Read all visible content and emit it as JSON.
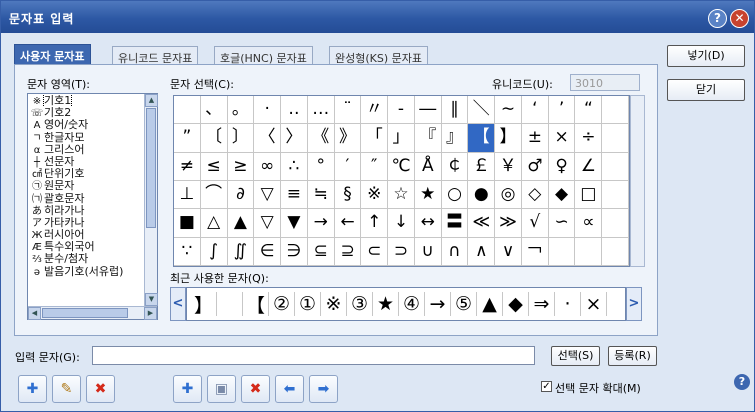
{
  "window": {
    "title": "문자표 입력",
    "help_glyph": "?",
    "close_glyph": "✕"
  },
  "tabs": [
    {
      "label": "사용자 문자표",
      "active": true
    },
    {
      "label": "유니코드 문자표",
      "active": false
    },
    {
      "label": "호글(HNC) 문자표",
      "active": false
    },
    {
      "label": "완성형(KS) 문자표",
      "active": false
    }
  ],
  "area_label": "문자 영역(T):",
  "areas": [
    {
      "icon": "※",
      "label": "기호1",
      "selected": true
    },
    {
      "icon": "☏",
      "label": "기호2"
    },
    {
      "icon": "A",
      "label": "영어/숫자"
    },
    {
      "icon": "ㄱ",
      "label": "한글자모"
    },
    {
      "icon": "α",
      "label": "그리스어"
    },
    {
      "icon": "┼",
      "label": "선문자"
    },
    {
      "icon": "㎠",
      "label": "단위기호"
    },
    {
      "icon": "㉠",
      "label": "원문자"
    },
    {
      "icon": "㈀",
      "label": "괄호문자"
    },
    {
      "icon": "あ",
      "label": "히라가나"
    },
    {
      "icon": "ア",
      "label": "가타카나"
    },
    {
      "icon": "Ж",
      "label": "러시아어"
    },
    {
      "icon": "Æ",
      "label": "특수외국어"
    },
    {
      "icon": "⅔",
      "label": "분수/첨자"
    },
    {
      "icon": "ǝ",
      "label": "발음기호(서유럽)"
    }
  ],
  "select_label": "문자 선택(C):",
  "unicode_label": "유니코드(U):",
  "unicode_value": "3010",
  "grid": [
    [
      "",
      "、",
      "。",
      "·",
      "‥",
      "…",
      "¨",
      "〃",
      "-",
      "―",
      "∥",
      "＼",
      "∼",
      "‘",
      "’",
      "“",
      ""
    ],
    [
      "”",
      "〔",
      "〕",
      "〈",
      "〉",
      "《",
      "》",
      "「",
      "」",
      "『",
      "』",
      "【",
      "】",
      "±",
      "×",
      "÷",
      ""
    ],
    [
      "≠",
      "≤",
      "≥",
      "∞",
      "∴",
      "°",
      "′",
      "″",
      "℃",
      "Å",
      "￠",
      "￡",
      "￥",
      "♂",
      "♀",
      "∠",
      ""
    ],
    [
      "⊥",
      "⌒",
      "∂",
      "▽",
      "≡",
      "≒",
      "§",
      "※",
      "☆",
      "★",
      "○",
      "●",
      "◎",
      "◇",
      "◆",
      "□",
      ""
    ],
    [
      "■",
      "△",
      "▲",
      "▽",
      "▼",
      "→",
      "←",
      "↑",
      "↓",
      "↔",
      "〓",
      "≪",
      "≫",
      "√",
      "∽",
      "∝",
      ""
    ],
    [
      "∵",
      "∫",
      "∬",
      "∈",
      "∋",
      "⊆",
      "⊇",
      "⊂",
      "⊃",
      "∪",
      "∩",
      "∧",
      "∨",
      "￢",
      "",
      "",
      ""
    ]
  ],
  "selected_char": "【",
  "recent_label": "최근 사용한 문자(Q):",
  "recent": [
    "】",
    "",
    "【",
    "②",
    "①",
    "※",
    "③",
    "★",
    "④",
    "→",
    "⑤",
    "▲",
    "◆",
    "⇒",
    "·",
    "×"
  ],
  "buttons": {
    "insert": "넣기(D)",
    "close": "닫기",
    "select": "선택(S)",
    "register": "등록(R)"
  },
  "input_label": "입력 문자(G):",
  "input_value": "",
  "zoom_label": "선택 문자 확대(M)",
  "zoom_checked": true,
  "zoom_check_glyph": "✓",
  "scroll_glyphs": {
    "up": "▲",
    "down": "▼",
    "left": "◀",
    "right": "▶",
    "prev": "<",
    "next": ">"
  },
  "toolbar": [
    {
      "name": "add-area-icon",
      "glyph": "✚"
    },
    {
      "name": "edit-area-icon",
      "glyph": "✎"
    },
    {
      "name": "delete-area-icon",
      "glyph": "✖"
    },
    {
      "name": "add-char-icon",
      "glyph": "✚"
    },
    {
      "name": "insert-char-icon",
      "glyph": "▣"
    },
    {
      "name": "delete-char-icon",
      "glyph": "✖"
    },
    {
      "name": "move-left-icon",
      "glyph": "⬅"
    },
    {
      "name": "move-right-icon",
      "glyph": "➡"
    }
  ],
  "colors": {
    "accent": "#3168c4",
    "title": "#2d58a4",
    "red": "#d42a1a",
    "blue": "#2f6fd0"
  }
}
